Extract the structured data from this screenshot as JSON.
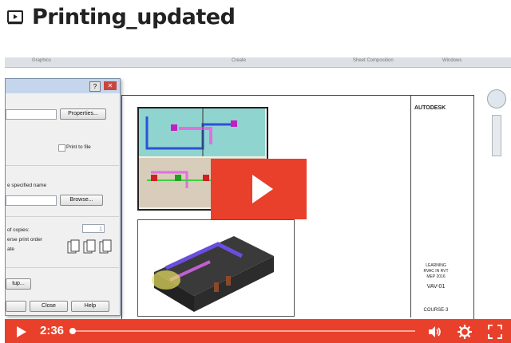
{
  "page": {
    "title": "Printing_updated"
  },
  "ribbon": {
    "labels": [
      "Graphics",
      "Create",
      "Sheet Composition",
      "Windows"
    ]
  },
  "dialog": {
    "properties_label": "Properties...",
    "print_to_file": "Print to file",
    "specified_name": "e specified name",
    "browse_label": "Browse...",
    "copies_label": "of copies:",
    "copies_value": "1",
    "reverse_order": "erse print order",
    "collate": "ate",
    "setup_label": "tup...",
    "close_label": "Close",
    "help_label": "Help"
  },
  "titleblock": {
    "company": "AUTODESK",
    "project_lines": [
      "LEARNING",
      "RVAC IN RVT",
      "MEP 2016"
    ],
    "sheet_name": "VAV-01",
    "course": "COURSE-3"
  },
  "player": {
    "time": "2:36",
    "progress_fraction": 0.0,
    "accent": "#e8402a"
  }
}
